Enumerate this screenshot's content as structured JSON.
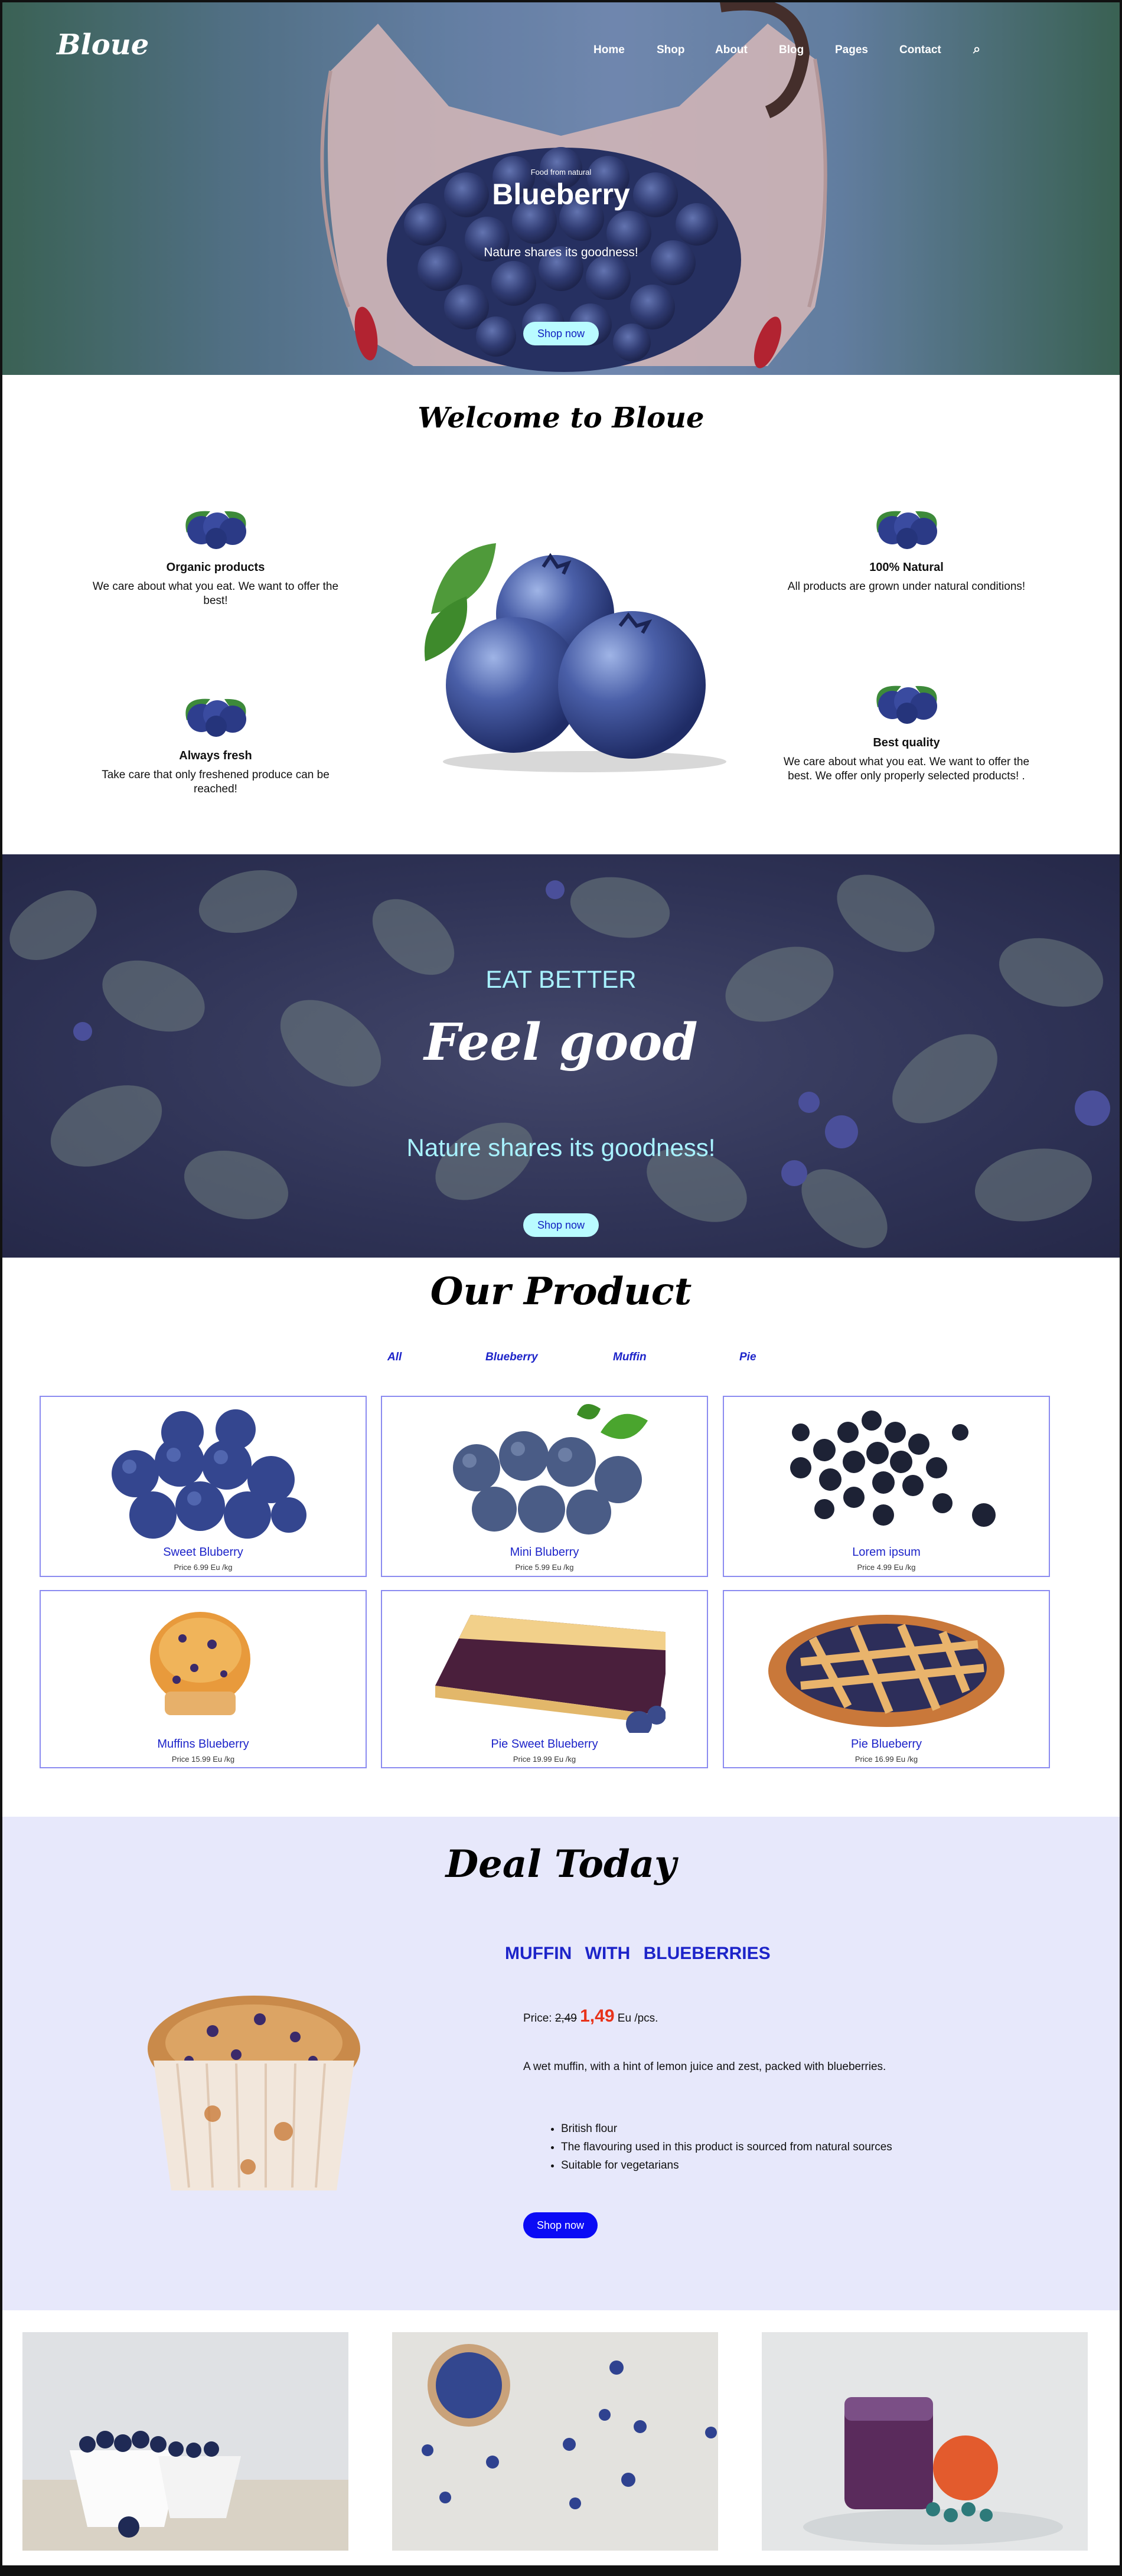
{
  "brand": {
    "logo": "Bloue"
  },
  "nav": {
    "items": [
      "Home",
      "Shop",
      "About",
      "Blog",
      "Pages",
      "Contact"
    ],
    "search_icon": "⌕"
  },
  "hero": {
    "kicker": "Food from natural",
    "title": "Blueberry",
    "subtitle": "Nature shares its goodness!",
    "button": "Shop now"
  },
  "welcome": {
    "title": "Welcome to Bloue",
    "features": [
      {
        "title": "Organic products",
        "text": "We care about what you eat. We want to offer the best!"
      },
      {
        "title": "Always fresh",
        "text": "Take care that only freshened produce can be reached!"
      },
      {
        "title": "100% Natural",
        "text": "All products are grown under natural conditions!"
      },
      {
        "title": "Best quality",
        "text": "We care about what you eat. We want to offer the best. We offer only properly selected products! ."
      }
    ]
  },
  "promo": {
    "kicker": "EAT BETTER",
    "title": "Feel good",
    "subtitle": "Nature shares its goodness!",
    "button": "Shop now"
  },
  "products": {
    "title": "Our Product",
    "filters": [
      "All",
      "Blueberry",
      "Muffin",
      "Pie"
    ],
    "items": [
      {
        "name": "Sweet Bluberry",
        "price": "Price 6.99 Eu /kg"
      },
      {
        "name": "Mini Bluberry",
        "price": "Price 5.99 Eu /kg"
      },
      {
        "name": "Lorem ipsum",
        "price": "Price 4.99 Eu /kg"
      },
      {
        "name": "Muffins Blueberry",
        "price": "Price 15.99 Eu /kg"
      },
      {
        "name": "Pie Sweet Blueberry",
        "price": "Price 19.99 Eu /kg"
      },
      {
        "name": "Pie Blueberry",
        "price": "Price 16.99 Eu /kg"
      }
    ]
  },
  "deal": {
    "title": "Deal Today",
    "product": "MUFFIN  WITH  BLUEBERRIES",
    "price_label": "Price:",
    "old_price": "2,49",
    "new_price": "1,49",
    "unit": "Eu /pcs.",
    "description": "A wet muffin, with a hint of lemon juice and zest, packed with blueberries.",
    "bullets": [
      "British flour",
      "The flavouring used in this product is sourced from natural sources",
      "Suitable for vegetarians"
    ],
    "button": "Shop now"
  },
  "colors": {
    "accent": "#1d24c9",
    "cyan_button": "#b9fbff",
    "deal_bg": "#e7e8fb",
    "sale": "#e8331b",
    "deal_button": "#0b0bf5"
  }
}
